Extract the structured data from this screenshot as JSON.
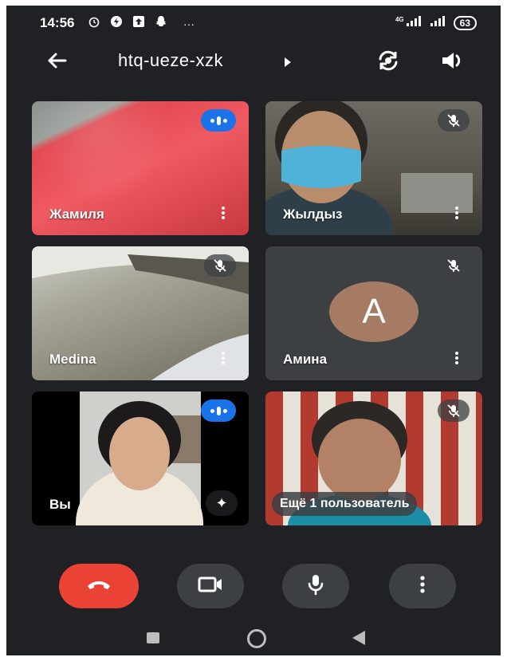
{
  "status_bar": {
    "time": "14:56",
    "more": "···",
    "network": "4G",
    "battery": "63"
  },
  "header": {
    "meeting_code": "htq-ueze-xzk"
  },
  "participants": [
    {
      "name": "Жамиля",
      "state": "speaking"
    },
    {
      "name": "Жылдыз",
      "state": "muted"
    },
    {
      "name": "Medina",
      "state": "muted"
    },
    {
      "name": "Амина",
      "state": "muted",
      "avatar_letter": "A",
      "avatar_color": "#a67b64"
    },
    {
      "name": "Вы",
      "state": "speaking"
    },
    {
      "more_label": "Ещё 1 пользователь",
      "state": "muted"
    }
  ],
  "controls": {
    "end_call_color": "#ea4335",
    "icons": [
      "end-call-icon",
      "camera-icon",
      "mic-icon",
      "more-vert-icon"
    ]
  },
  "colors": {
    "background": "#202124",
    "tile_background": "#3c4043",
    "speaking_badge": "#1a73e8"
  }
}
